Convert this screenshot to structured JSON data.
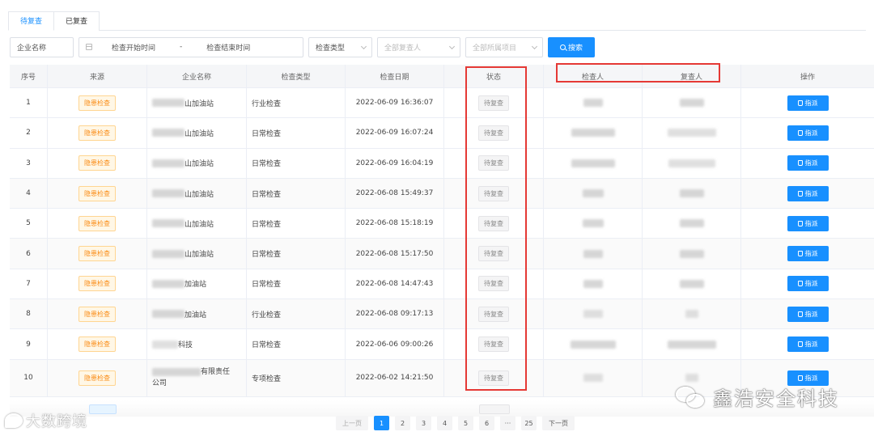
{
  "tabs": [
    {
      "label": "待复查",
      "active": true
    },
    {
      "label": "已复查",
      "active": false
    }
  ],
  "filters": {
    "company_placeholder": "企业名称",
    "start_time_placeholder": "检查开始时间",
    "range_separator": "-",
    "end_time_placeholder": "检查结束时间",
    "check_type": "检查类型",
    "reviewer": "全部复查人",
    "project": "全部所属项目",
    "search_label": "搜索"
  },
  "table": {
    "headers": [
      "序号",
      "来源",
      "企业名称",
      "检查类型",
      "检查日期",
      "状态",
      "检查人",
      "复查人",
      "操作"
    ],
    "rows": [
      {
        "index": "1",
        "source": "隐患检查",
        "company": "山加油站",
        "type": "行业检查",
        "date": "2022-06-09 16:36:07",
        "status": "待复查",
        "action": "指派"
      },
      {
        "index": "2",
        "source": "隐患检查",
        "company": "山加油站",
        "type": "日常检查",
        "date": "2022-06-09 16:07:24",
        "status": "待复查",
        "action": "指派"
      },
      {
        "index": "3",
        "source": "隐患检查",
        "company": "山加油站",
        "type": "日常检查",
        "date": "2022-06-09 16:04:19",
        "status": "待复查",
        "action": "指派"
      },
      {
        "index": "4",
        "source": "隐患检查",
        "company": "山加油站",
        "type": "日常检查",
        "date": "2022-06-08 15:49:37",
        "status": "待复查",
        "action": "指派"
      },
      {
        "index": "5",
        "source": "隐患检查",
        "company": "山加油站",
        "type": "日常检查",
        "date": "2022-06-08 15:18:19",
        "status": "待复查",
        "action": "指派"
      },
      {
        "index": "6",
        "source": "隐患检查",
        "company": "山加油站",
        "type": "日常检查",
        "date": "2022-06-08 15:17:50",
        "status": "待复查",
        "action": "指派"
      },
      {
        "index": "7",
        "source": "隐患检查",
        "company": "加油站",
        "type": "日常检查",
        "date": "2022-06-08 14:47:43",
        "status": "待复查",
        "action": "指派"
      },
      {
        "index": "8",
        "source": "隐患检查",
        "company": "加油站",
        "type": "行业检查",
        "date": "2022-06-08 09:17:13",
        "status": "待复查",
        "action": "指派"
      },
      {
        "index": "9",
        "source": "隐患检查",
        "company": "科技",
        "type": "日常检查",
        "date": "2022-06-06 09:00:26",
        "status": "待复查",
        "action": "指派"
      },
      {
        "index": "10",
        "source": "隐患检查",
        "company_line1": "有限责任",
        "company_line2": "公司",
        "type": "专项检查",
        "date": "2022-06-02 14:21:50",
        "status": "待复查",
        "action": "指派"
      }
    ]
  },
  "pagination": {
    "prev": "上一页",
    "pages": [
      "1",
      "2",
      "3",
      "4",
      "5",
      "6",
      "···",
      "25"
    ],
    "current": "1",
    "next": "下一页"
  },
  "watermarks": {
    "left": "大数跨境",
    "right": "鑫浩安全科技"
  },
  "colors": {
    "primary": "#1890ff",
    "source_tag": "#fa8c16",
    "annotation": "#e53935"
  }
}
